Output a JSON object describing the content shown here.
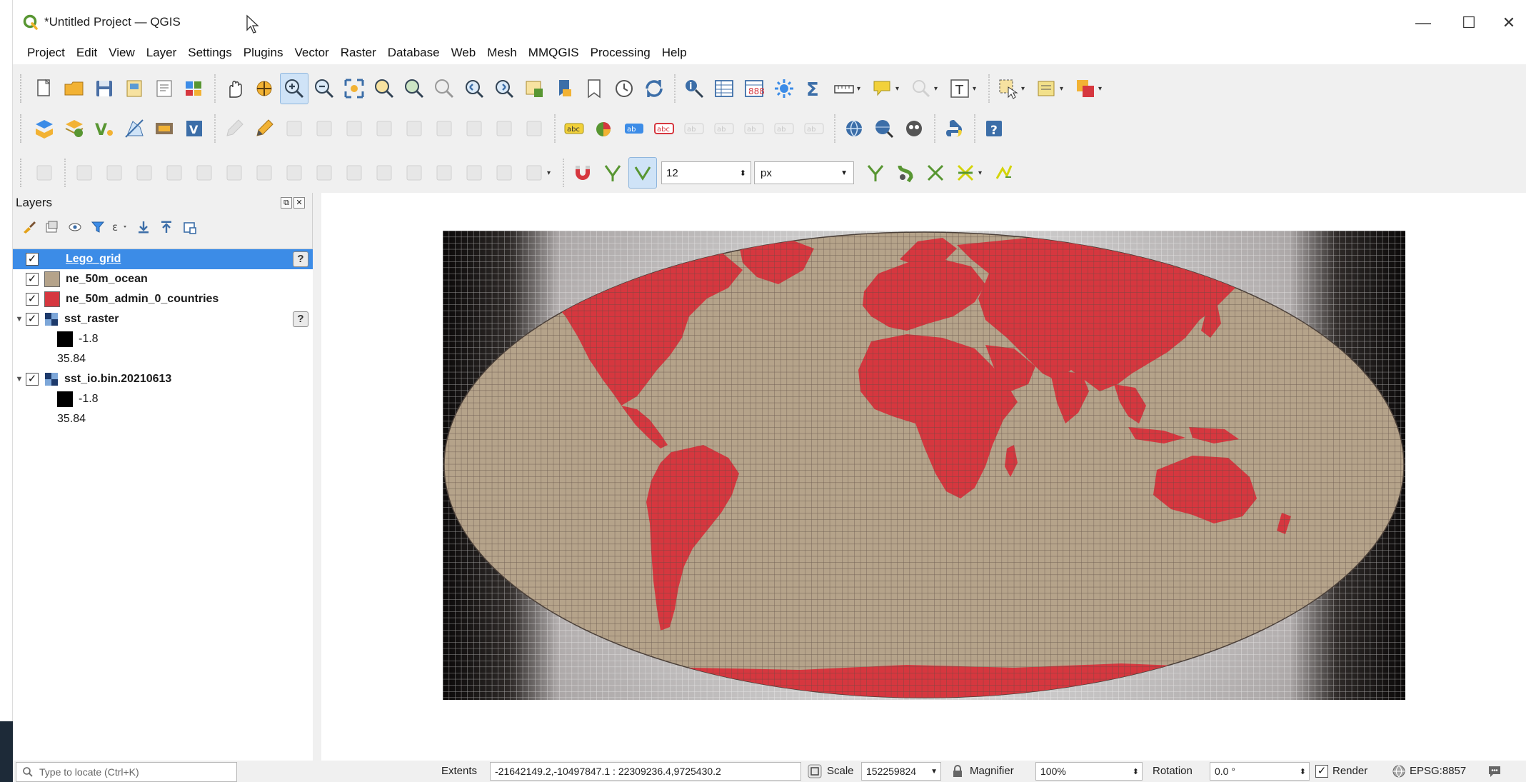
{
  "window": {
    "title": "*Untitled Project — QGIS",
    "minimize": "—",
    "maximize": "☐",
    "close": "✕"
  },
  "menu": [
    "Project",
    "Edit",
    "View",
    "Layer",
    "Settings",
    "Plugins",
    "Vector",
    "Raster",
    "Database",
    "Web",
    "Mesh",
    "MMQGIS",
    "Processing",
    "Help"
  ],
  "snapping": {
    "tolerance_value": "12",
    "tolerance_unit": "px"
  },
  "layers_panel": {
    "title": "Layers",
    "layers": [
      {
        "name": "Lego_grid",
        "checked": "✓",
        "swatch": "#3c8ce7",
        "selected": true,
        "help": "?"
      },
      {
        "name": "ne_50m_ocean",
        "checked": "✓",
        "swatch": "#b5a38a"
      },
      {
        "name": "ne_50m_admin_0_countries",
        "checked": "✓",
        "swatch": "#d6373f"
      },
      {
        "name": "sst_raster",
        "checked": "✓",
        "expander": "▼",
        "help": "?",
        "legend": [
          "-1.8",
          "35.84"
        ]
      },
      {
        "name": "sst_io.bin.20210613",
        "checked": "✓",
        "expander": "▼",
        "legend": [
          "-1.8",
          "35.84"
        ]
      }
    ]
  },
  "status": {
    "locate_placeholder": "Type to locate (Ctrl+K)",
    "extents_label": "Extents",
    "extents_value": "-21642149.2,-10497847.1 : 22309236.4,9725430.2",
    "scale_label": "Scale",
    "scale_value": "152259824",
    "magnifier_label": "Magnifier",
    "magnifier_value": "100%",
    "rotation_label": "Rotation",
    "rotation_value": "0.0 °",
    "render_label": "Render",
    "render_checked": "✓",
    "crs": "EPSG:8857"
  },
  "colors": {
    "ocean": "#b5a38a",
    "land": "#d6373f",
    "grid_line": "#5a4a42",
    "selection": "#3c8ce7"
  }
}
